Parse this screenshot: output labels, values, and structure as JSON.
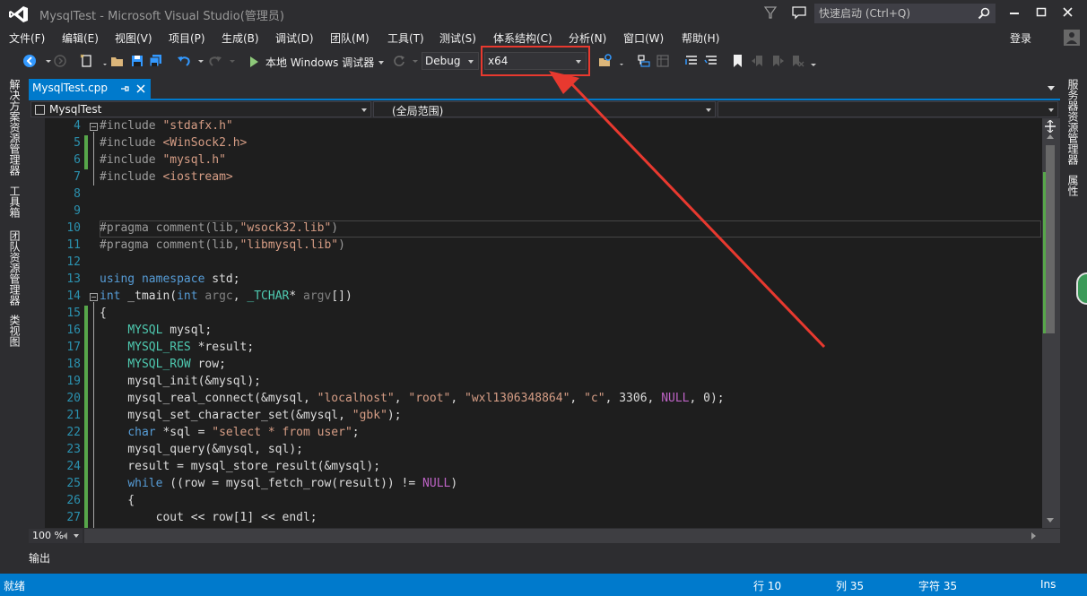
{
  "window": {
    "title": "MysqlTest - Microsoft Visual Studio(管理员)",
    "quick_launch_placeholder": "快速启动 (Ctrl+Q)"
  },
  "menu": {
    "items": [
      "文件(F)",
      "编辑(E)",
      "视图(V)",
      "项目(P)",
      "生成(B)",
      "调试(D)",
      "团队(M)",
      "工具(T)",
      "测试(S)",
      "体系结构(C)",
      "分析(N)",
      "窗口(W)",
      "帮助(H)"
    ],
    "login": "登录"
  },
  "toolbar": {
    "run_label": "本地 Windows 调试器",
    "configuration": "Debug",
    "platform": "x64"
  },
  "side_tabs": {
    "left": [
      "解决方案资源管理器",
      "工具箱",
      "团队资源管理器",
      "类视图"
    ],
    "right": [
      "服务器资源管理器",
      "属性"
    ]
  },
  "document": {
    "tab_label": "MysqlTest.cpp",
    "nav_project": "MysqlTest",
    "nav_scope": "(全局范围)"
  },
  "code": {
    "line_numbers": [
      "4",
      "5",
      "6",
      "7",
      "8",
      "9",
      "10",
      "11",
      "12",
      "13",
      "14",
      "15",
      "16",
      "17",
      "18",
      "19",
      "20",
      "21",
      "22",
      "23",
      "24",
      "25",
      "26",
      "27"
    ]
  },
  "zoom": "100 %",
  "output_tab": "输出",
  "status": {
    "ready": "就绪",
    "line": "行 10",
    "col": "列 35",
    "char": "字符 35",
    "mode": "Ins"
  },
  "colors": {
    "accent": "#007acc",
    "annotation": "#e8392f",
    "keyword": "#569cd6",
    "string": "#d69d85",
    "type": "#4ec9b0",
    "macro": "#bd63c5"
  }
}
